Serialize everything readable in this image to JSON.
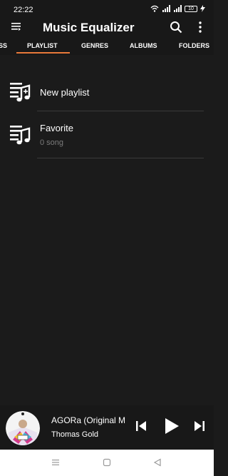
{
  "status_bar": {
    "time": "22:22",
    "battery_level": "10",
    "icons": [
      "wifi-icon",
      "signal-icon",
      "signal-icon",
      "battery-icon",
      "charging-icon"
    ]
  },
  "app_bar": {
    "title": "Music Equalizer",
    "icons": [
      "menu-icon",
      "search-icon",
      "more-vert-icon"
    ]
  },
  "tabs": {
    "items": [
      "SS",
      "PLAYLIST",
      "GENRES",
      "ALBUMS",
      "FOLDERS"
    ],
    "active": "PLAYLIST"
  },
  "playlists": [
    {
      "title": "New playlist",
      "icon": "add-playlist-icon"
    },
    {
      "title": "Favorite",
      "subtitle": "0 song",
      "icon": "playlist-icon"
    }
  ],
  "now_playing": {
    "title": "AGORa (Original M",
    "artist": "Thomas Gold",
    "controls": [
      "previous-icon",
      "play-icon",
      "next-icon"
    ]
  },
  "nav_bar": {
    "icons": [
      "menu-icon",
      "home-icon",
      "back-icon"
    ]
  },
  "colors": {
    "accent": "#e8793a",
    "background": "#1b1b1b",
    "bar": "#181818",
    "subtitle": "#7c7c7c"
  }
}
